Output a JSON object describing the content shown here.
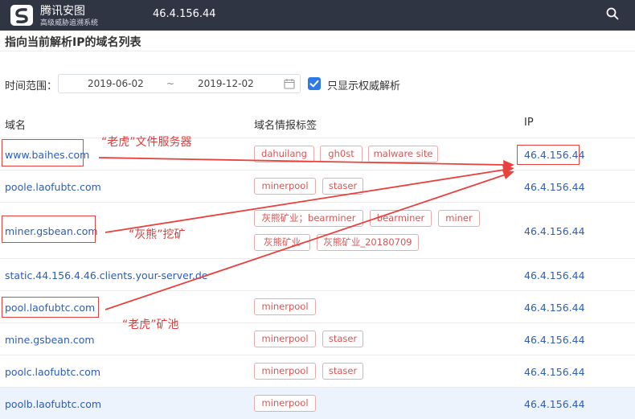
{
  "header": {
    "brand_title": "腾讯安图",
    "brand_subtitle": "高级威胁追溯系统",
    "search_value": "46.4.156.44"
  },
  "section": {
    "title": "指向当前解析IP的域名列表"
  },
  "filters": {
    "time_range_label": "时间范围：",
    "start_date": "2019-06-02",
    "separator": "~",
    "end_date": "2019-12-02",
    "authoritative_only_label": "只显示权威解析",
    "authoritative_only_checked": true
  },
  "table": {
    "columns": {
      "domain": "域名",
      "tags": "域名情报标签",
      "ip": "IP"
    },
    "rows": [
      {
        "domain": "www.baihes.com",
        "ip": "46.4.156.44",
        "tags": [
          "dahuilang",
          "gh0st",
          "malware site"
        ]
      },
      {
        "domain": "poole.laofubtc.com",
        "ip": "46.4.156.44",
        "tags": [
          "minerpool",
          "staser"
        ]
      },
      {
        "domain": "miner.gsbean.com",
        "ip": "46.4.156.44",
        "tags": [
          "灰熊矿业；bearminer",
          "bearminer",
          "miner",
          "灰熊矿业",
          "灰熊矿业_20180709"
        ]
      },
      {
        "domain": "static.44.156.4.46.clients.your-server.de",
        "ip": "46.4.156.44",
        "tags": []
      },
      {
        "domain": "pool.laofubtc.com",
        "ip": "46.4.156.44",
        "tags": [
          "minerpool"
        ]
      },
      {
        "domain": "mine.gsbean.com",
        "ip": "46.4.156.44",
        "tags": [
          "minerpool",
          "staser"
        ]
      },
      {
        "domain": "poolc.laofubtc.com",
        "ip": "46.4.156.44",
        "tags": [
          "minerpool",
          "staser"
        ]
      },
      {
        "domain": "poolb.laofubtc.com",
        "ip": "46.4.156.44",
        "tags": [
          "minerpool"
        ]
      }
    ]
  },
  "annotations": {
    "tiger_file_server": "“老虎”文件服务器",
    "grizzly_mining": "“灰熊”挖矿",
    "tiger_pool": "“老虎”矿池",
    "color": "#e8413e"
  },
  "colors": {
    "topbar": "#2f3542",
    "link": "#2e5cb8",
    "tag_text": "#e05353",
    "tag_border": "#f0a9a9",
    "checkbox": "#2e7be6",
    "row_highlight": "#edf3fc"
  }
}
